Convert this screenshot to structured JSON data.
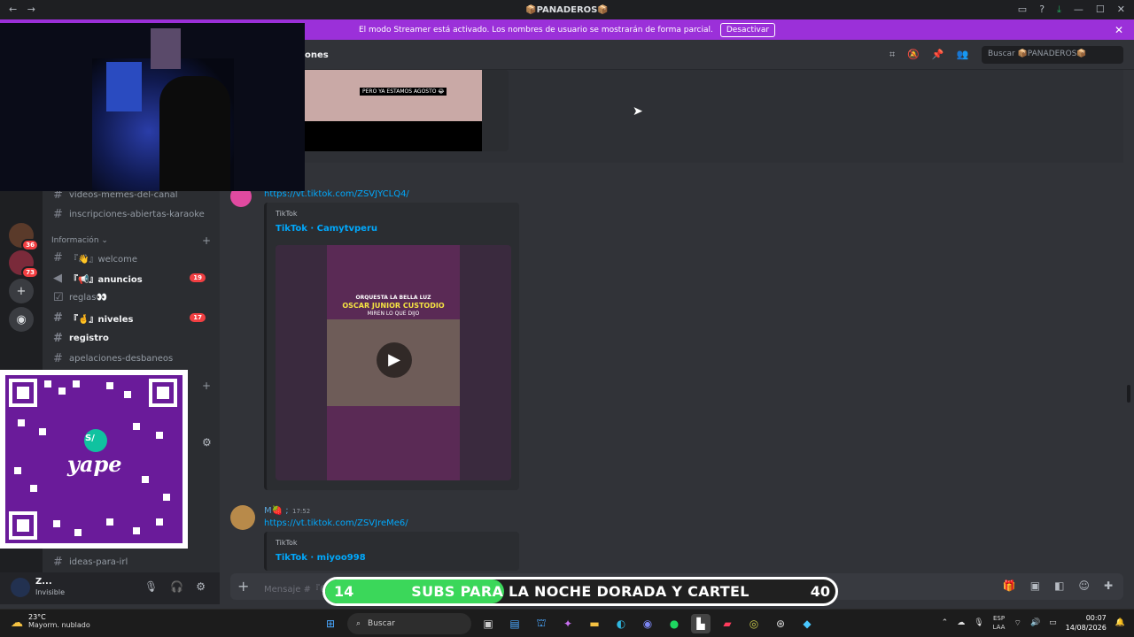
{
  "titlebar": {
    "title": "📦PANADEROS📦",
    "back": "←",
    "forward": "→"
  },
  "streamer": {
    "message": "El modo Streamer está activado. Los nombres de usuario se mostrarán de forma parcial.",
    "button": "Desactivar",
    "close": "✕"
  },
  "servers": [
    {
      "badge": "36"
    },
    {
      "badge": "73"
    }
  ],
  "channels": {
    "items": [
      {
        "name": "videos-memes-del-canal"
      },
      {
        "name": "inscripciones-abiertas-karaoke"
      },
      {
        "name": "『👋』welcome"
      },
      {
        "name": "『📢』anuncios",
        "badge": "19"
      },
      {
        "name": "reglas👀"
      },
      {
        "name": "『🤞』niveles",
        "badge": "17"
      },
      {
        "name": "registro"
      },
      {
        "name": "apelaciones-desbaneos"
      },
      {
        "name": "ideas-para-irl"
      }
    ],
    "category_info": "Información ⌄"
  },
  "user": {
    "name": "Z...",
    "status": "Invisible"
  },
  "header": {
    "channel": "ones",
    "search_placeholder": "Buscar 📦PANADEROS📦"
  },
  "embed1": {
    "caption": "PERO YA ESTAMOS AGOSTO 😂"
  },
  "message2": {
    "link": "https://vt.tiktok.com/ZSVJYCLQ4/",
    "provider": "TikTok",
    "title": "TikTok · Camytvperu",
    "video_line1": "ORQUESTA LA BELLA LUZ",
    "video_line2": "OSCAR JUNIOR CUSTODIO",
    "video_line3": "MIREN LO QUE DIJO"
  },
  "message3": {
    "author": "M🍓 ;",
    "time": "17:52",
    "link": "https://vt.tiktok.com/ZSVJreMe6/",
    "provider": "TikTok",
    "title": "TikTok · miyoo998"
  },
  "composer": {
    "placeholder": "Mensaje #『😄"
  },
  "subs_bar": {
    "current": "14",
    "label": "SUBS PARA LA NOCHE DORADA Y CARTEL",
    "goal": "40",
    "progress": 0.35
  },
  "qr": {
    "brand": "yape",
    "logo": "S/"
  },
  "taskbar": {
    "temp": "23°C",
    "weather": "Mayorm. nublado",
    "search": "Buscar",
    "lang1": "ESP",
    "lang2": "LAA",
    "time": "00:07",
    "date": "14/08/2026"
  },
  "colors": {
    "accent": "#9b30d9",
    "link": "#00a8fc",
    "badge": "#f23f42",
    "progress": "#3bd75a"
  }
}
